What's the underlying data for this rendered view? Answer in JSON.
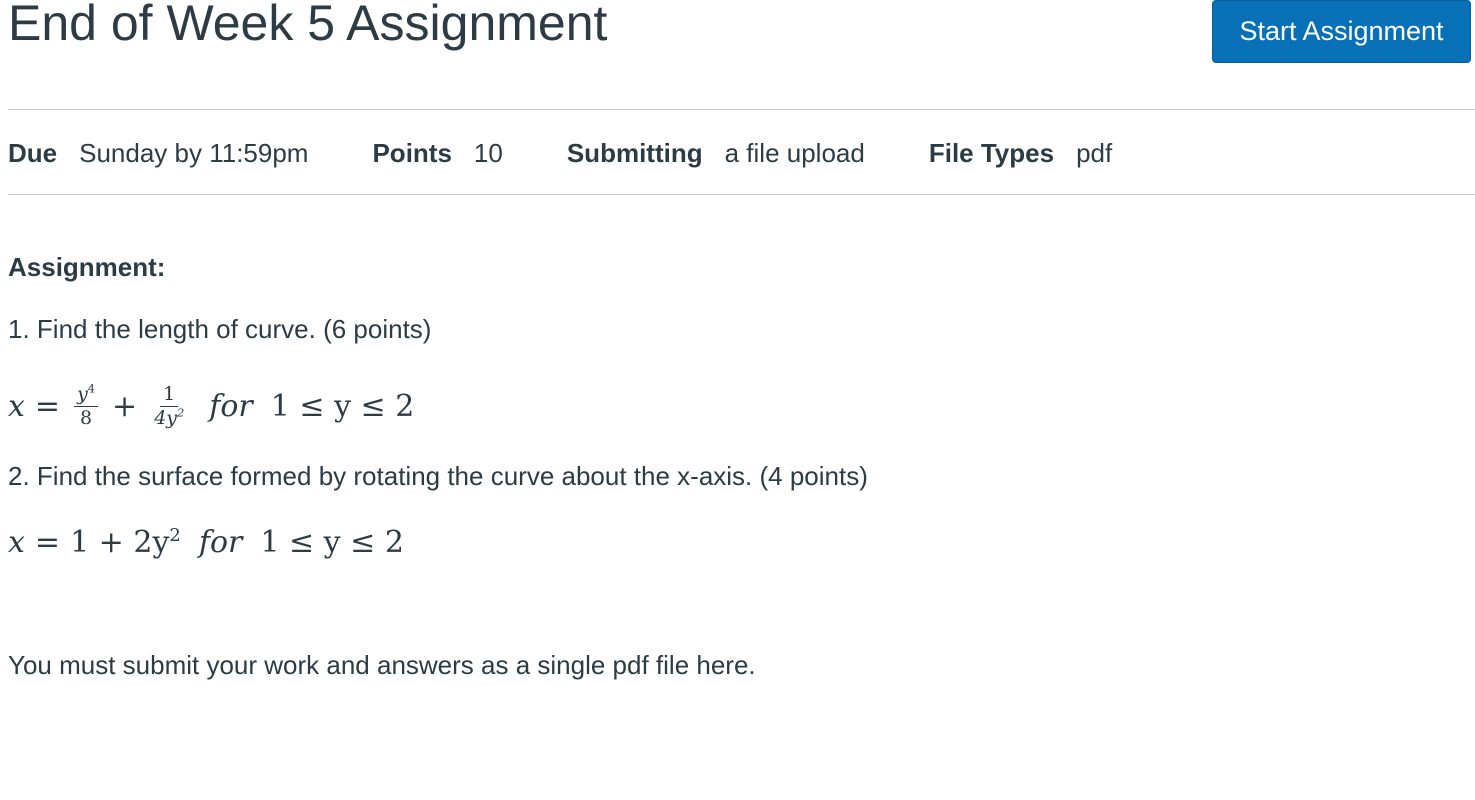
{
  "header": {
    "title": "End of Week 5 Assignment",
    "start_button_label": "Start Assignment"
  },
  "details": {
    "due_label": "Due",
    "due_value": "Sunday by 11:59pm",
    "points_label": "Points",
    "points_value": "10",
    "submitting_label": "Submitting",
    "submitting_value": "a file upload",
    "file_types_label": "File Types",
    "file_types_value": "pdf"
  },
  "body": {
    "heading": "Assignment:",
    "q1": "1.  Find the length of curve. (6 points)",
    "q1_math": {
      "x": "x",
      "eq": "=",
      "frac1_num": "y",
      "frac1_num_exp": "4",
      "frac1_den": "8",
      "plus": "+",
      "frac2_num": "1",
      "frac2_den": "4y",
      "frac2_den_exp": "2",
      "for": "for",
      "range": "1 ≤ y ≤ 2"
    },
    "q2": "2.  Find the surface formed by rotating the curve about the x-axis. (4 points)",
    "q2_math": {
      "x": "x",
      "eq": "=",
      "expr": "1 + 2y",
      "expr_exp": "2",
      "for": "for",
      "range": "1 ≤ y ≤ 2"
    },
    "note": "You must submit your work and answers as a single pdf file here."
  }
}
